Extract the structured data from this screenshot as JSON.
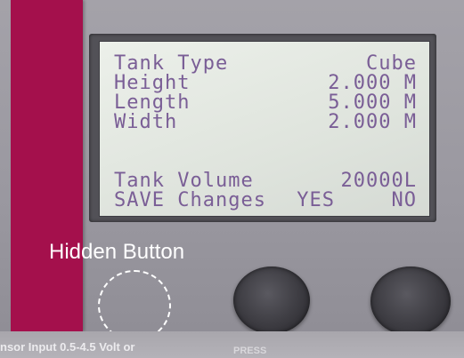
{
  "lcd": {
    "rows": [
      {
        "label": "Tank Type",
        "value": "Cube"
      },
      {
        "label": "Height",
        "value": "2.000 M"
      },
      {
        "label": "Length",
        "value": "5.000 M"
      },
      {
        "label": "Width",
        "value": "2.000 M"
      }
    ],
    "volume": {
      "label": "Tank Volume",
      "value": "20000L"
    },
    "save": {
      "label": "SAVE Changes",
      "yes": "YES",
      "no": "NO"
    }
  },
  "annotation": {
    "hidden_button_label": "Hidden Button"
  },
  "panel_text": {
    "sensor": "nsor Input  0.5-4.5 Volt or",
    "faint": "PRESS"
  },
  "colors": {
    "lcd_text": "#7a5e96",
    "lcd_background": "#e3e8e1",
    "accent_strip": "#a4104c",
    "panel": "#9e9ca3",
    "knob": "#3f3e44"
  }
}
